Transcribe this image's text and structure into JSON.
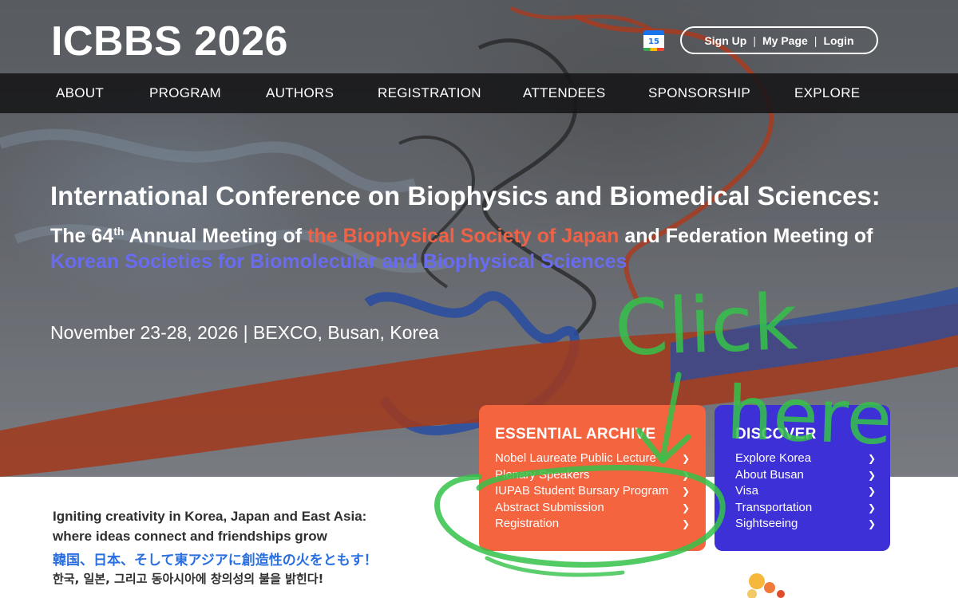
{
  "header": {
    "logo_text": "ICBBS 2026",
    "calendar_icon_day": "15",
    "auth": {
      "signup": "Sign Up",
      "mypage": "My Page",
      "login": "Login",
      "separator": "|"
    }
  },
  "nav": {
    "items": [
      "ABOUT",
      "PROGRAM",
      "AUTHORS",
      "REGISTRATION",
      "ATTENDEES",
      "SPONSORSHIP",
      "EXPLORE"
    ]
  },
  "hero": {
    "title": "International Conference on Biophysics and Biomedical Sciences:",
    "subtitle_part1": "The 64",
    "subtitle_sup": "th",
    "subtitle_part2": " Annual Meeting of ",
    "subtitle_highlight1": "the Biophysical Society of Japan",
    "subtitle_part3": " and Federation Meeting of ",
    "subtitle_highlight2": "Korean Societies for Biomolecular and Biophysical Sciences",
    "date_venue": "November 23-28, 2026 | BEXCO, Busan, Korea"
  },
  "archive_card": {
    "title": "ESSENTIAL ARCHIVE",
    "items": [
      "Nobel Laureate Public Lecture",
      "Plenary Speakers",
      "IUPAB Student Bursary Program",
      "Abstract Submission",
      "Registration"
    ]
  },
  "discover_card": {
    "title": "DISCOVER",
    "items": [
      "Explore Korea",
      "About Busan",
      "Visa",
      "Transportation",
      "Sightseeing"
    ]
  },
  "tagline": {
    "en_line1": "Igniting creativity in Korea, Japan and East Asia:",
    "en_line2": "where ideas connect and friendships grow",
    "ja": "韓国、日本、そして東アジアに創造性の火をともす！",
    "ko": "한국, 일본, 그리고 동아시아에 창의성의 불을 밝힌다!"
  },
  "annotation": {
    "click_text": "Click",
    "here_text": "here",
    "color": "#35c24a"
  },
  "colors": {
    "accent_red": "#f3643f",
    "accent_blue": "#3d30d6",
    "highlight_red": "#f06246",
    "highlight_blue": "#6a6cf0",
    "nav_bg": "#161618"
  },
  "icons": {
    "chevron": "chevron-right-icon",
    "calendar": "google-calendar-icon"
  }
}
